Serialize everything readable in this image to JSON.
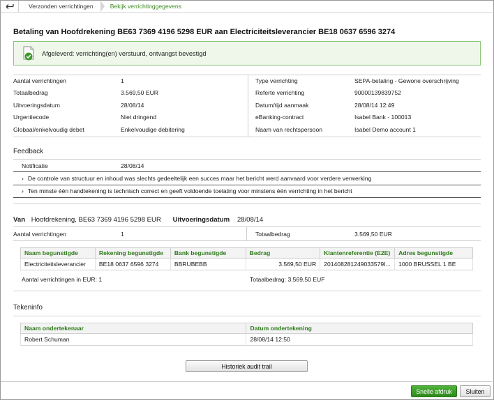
{
  "breadcrumb": {
    "items": [
      "Verzonden verrichtingen",
      "Bekijk verrichtinggegevens"
    ]
  },
  "title": "Betaling van Hoofdrekening BE63 7369 4196 5298 EUR aan Electriciteitsleverancier BE18 0637 6596 3274",
  "status": "Afgeleverd: verrichting(en) verstuurd, ontvangst bevestigd",
  "details_left": [
    {
      "label": "Aantal verrichtingen",
      "value": "1"
    },
    {
      "label": "Totaalbedrag",
      "value": "3.569,50 EUR"
    },
    {
      "label": "Uitvoeringsdatum",
      "value": "28/08/14"
    },
    {
      "label": "Urgentiecode",
      "value": "Niet dringend"
    },
    {
      "label": "Globaal/enkelvoudig debet",
      "value": "Enkelvoudige debitering"
    }
  ],
  "details_right": [
    {
      "label": "Type verrichting",
      "value": "SEPA-betaling - Gewone overschrijving"
    },
    {
      "label": "Referte verrichting",
      "value": "90000139839752"
    },
    {
      "label": "Datum/tijd aanmaak",
      "value": "28/08/14 12:49"
    },
    {
      "label": "eBanking-contract",
      "value": "Isabel Bank - 100013"
    },
    {
      "label": "Naam van rechtspersoon",
      "value": "Isabel Demo account 1"
    }
  ],
  "feedback": {
    "title": "Feedback",
    "notificatie_label": "Notificatie",
    "notificatie_value": "28/08/14",
    "messages": [
      "De controle van structuur en inhoud was slechts gedeeltelijk een succes maar het bericht werd aanvaard voor verdere verwerking",
      "Ten minste één handtekening is technisch correct en geeft voldoende toelating voor minstens één verrichting in het bericht"
    ]
  },
  "van": {
    "label": "Van",
    "account": "Hoofdrekening, BE63 7369 4196 5298 EUR",
    "date_label": "Uitvoeringsdatum",
    "date": "28/08/14",
    "count_label": "Aantal verrichtingen",
    "count": "1",
    "total_label": "Totaalbedrag",
    "total": "3.569,50 EUR"
  },
  "beneficiaries": {
    "headers": [
      "Naam begunstigde",
      "Rekening begunstigde",
      "Bank begunstigde",
      "Bedrag",
      "Klantenreferentie (E2E)",
      "Adres begunstigde"
    ],
    "rows": [
      [
        "Electriciteitsleverancier",
        "BE18 0637 6596 3274",
        "BBRUBEBB",
        "3.569,50 EUR",
        "201408281249033579I...",
        "1000 BRUSSEL 1 BE"
      ]
    ],
    "footer_count": "Aantal verrichtingen in EUR: 1",
    "footer_total": "Totaalbedrag: 3.569,50 EUF"
  },
  "tekeninfo": {
    "title": "Tekeninfo",
    "headers": [
      "Naam ondertekenaar",
      "Datum ondertekening"
    ],
    "rows": [
      [
        "Robert Schuman",
        "28/08/14 12:50"
      ]
    ]
  },
  "buttons": {
    "audit": "Historiek audit trail",
    "print": "Snelle afdruk",
    "close": "Sluiten"
  }
}
